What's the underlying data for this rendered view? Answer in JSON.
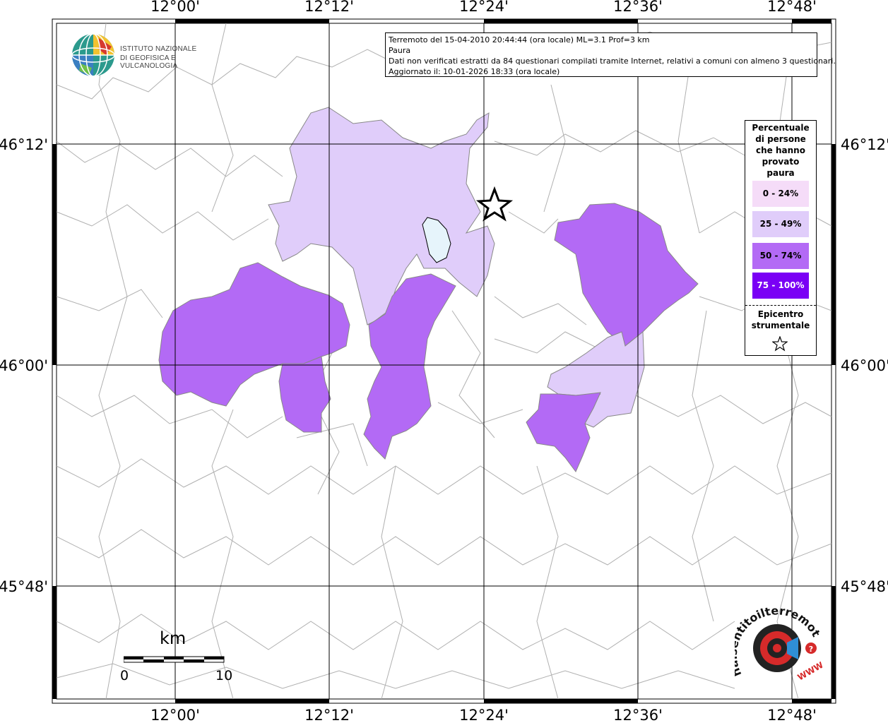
{
  "map": {
    "title_line1": "Terremoto del 15-04-2010 20:44:44 (ora locale) ML=3.1 Prof=3 km",
    "title_line2": "Paura",
    "title_line3": "Dati non verificati estratti da 84 questionari compilati tramite Internet, relativi a comuni con almeno 3 questionari.",
    "title_line4": "Aggiornato il: 10-01-2026 18:33 (ora locale)",
    "lon_labels": [
      "12°00'",
      "12°12'",
      "12°24'",
      "12°36'",
      "12°48'"
    ],
    "lat_labels": [
      "46°12'",
      "46°00'",
      "45°48'"
    ],
    "colors": {
      "class_0_24": "#f5dcf8",
      "class_25_49": "#e0cdfa",
      "class_50_74": "#b36af5",
      "class_75_100": "#7a00f5",
      "lake": "#e6f4fb",
      "border": "#aaaaaa"
    }
  },
  "legend": {
    "title": "Percentuale di persone che hanno provato paura",
    "items": [
      {
        "label": "0 - 24%",
        "color": "#f5dcf8",
        "text_color": "#000"
      },
      {
        "label": "25 - 49%",
        "color": "#e0cdfa",
        "text_color": "#000"
      },
      {
        "label": "50 - 74%",
        "color": "#b36af5",
        "text_color": "#000"
      },
      {
        "label": "75 - 100%",
        "color": "#7a00f5",
        "text_color": "#fff"
      }
    ],
    "epicenter_label": "Epicentro strumentale",
    "epicenter_icon": "star-icon"
  },
  "scale": {
    "unit": "km",
    "min": "0",
    "max": "10"
  },
  "logos": {
    "ingv_line1": "ISTITUTO NAZIONALE",
    "ingv_line2": "DI GEOFISICA E VULCANOLOGIA",
    "hst_text": "haisentitoilterremoto.it",
    "hst_www": "WWW"
  }
}
